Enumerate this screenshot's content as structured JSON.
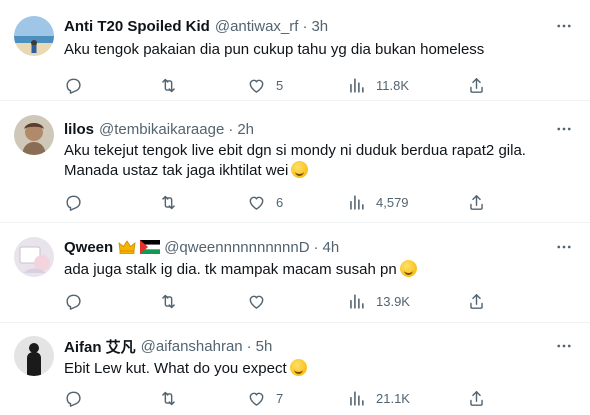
{
  "tweets": [
    {
      "name": "Anti T20 Spoiled Kid",
      "handle": "@antiwax_rf",
      "time": "3h",
      "text": "Aku tengok pakaian dia pun cukup tahu yg dia bukan homeless",
      "replies": "",
      "retweets": "",
      "likes": "5",
      "views": "11.8K"
    },
    {
      "name": "lilos",
      "handle": "@tembikaikaraage",
      "time": "2h",
      "text_line1": "Aku tekejut tengok live ebit dgn si mondy ni duduk berdua rapat2 gila.",
      "text_line2": "Manada ustaz tak jaga ikhtilat wei",
      "replies": "",
      "retweets": "",
      "likes": "6",
      "views": "4,579"
    },
    {
      "name": "Qween",
      "handle": "@qweennnnnnnnnnD",
      "time": "4h",
      "text": "ada juga stalk ig dia. tk mampak macam susah pn",
      "replies": "",
      "retweets": "",
      "likes": "",
      "views": "13.9K"
    },
    {
      "name": "Aifan 艾凡",
      "handle": "@aifanshahran",
      "time": "5h",
      "text": "Ebit Lew kut. What do you expect",
      "replies": "",
      "retweets": "",
      "likes": "7",
      "views": "21.1K"
    }
  ],
  "separator": "·",
  "icons": [
    "reply-icon",
    "retweet-icon",
    "like-icon",
    "views-icon",
    "share-icon",
    "more-icon"
  ],
  "colors": {
    "text": "#0f1419",
    "secondary": "#536471",
    "divider": "#eff3f4"
  }
}
